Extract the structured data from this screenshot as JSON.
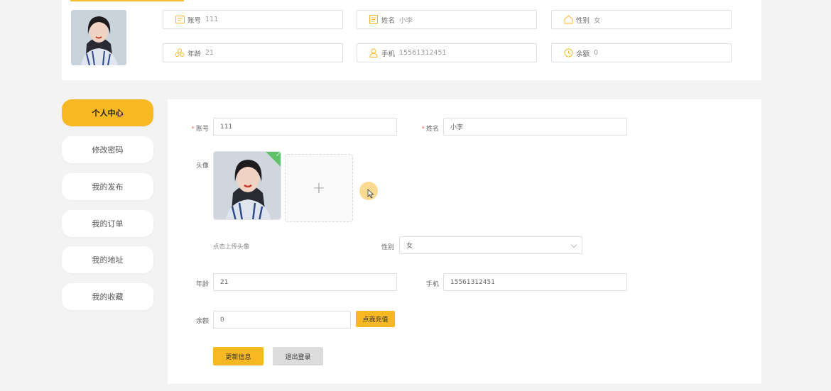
{
  "profile": {
    "account": {
      "label": "账号",
      "value": "111"
    },
    "name": {
      "label": "姓名",
      "value": "小李"
    },
    "gender": {
      "label": "性别",
      "value": "女"
    },
    "age": {
      "label": "年龄",
      "value": "21"
    },
    "phone": {
      "label": "手机",
      "value": "15561312451"
    },
    "balance": {
      "label": "余额",
      "value": "0"
    }
  },
  "sidebar": {
    "items": [
      {
        "label": "个人中心"
      },
      {
        "label": "修改密码"
      },
      {
        "label": "我的发布"
      },
      {
        "label": "我的订单"
      },
      {
        "label": "我的地址"
      },
      {
        "label": "我的收藏"
      }
    ]
  },
  "form": {
    "account_label": "账号",
    "account_value": "111",
    "name_label": "姓名",
    "name_value": "小李",
    "avatar_label": "头像",
    "upload_plus": "+",
    "upload_tip": "点击上传头像",
    "gender_label": "性别",
    "gender_value": "女",
    "age_label": "年龄",
    "age_value": "21",
    "phone_label": "手机",
    "phone_value": "15561312451",
    "balance_label": "余额",
    "balance_value": "0",
    "recharge_button": "点我充值",
    "update_button": "更新信息",
    "logout_button": "退出登录",
    "required_mark": "*"
  },
  "colors": {
    "accent": "#f7b824",
    "required": "#f56c6c",
    "success": "#5ec26a"
  },
  "icons": [
    "id-card-icon",
    "document-icon",
    "home-icon",
    "people-icon",
    "user-icon",
    "clock-icon",
    "check-icon",
    "plus-icon",
    "chevron-down-icon",
    "cursor-icon"
  ]
}
